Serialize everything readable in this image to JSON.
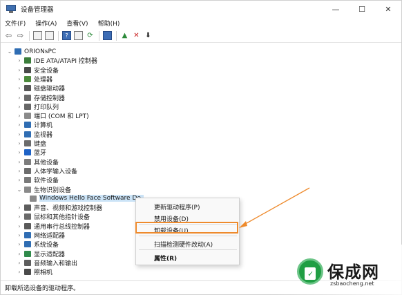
{
  "window": {
    "title": "设备管理器",
    "controls": {
      "minimize": "—",
      "maximize": "☐",
      "close": "✕"
    }
  },
  "menubar": {
    "items": [
      "文件(F)",
      "操作(A)",
      "查看(V)",
      "帮助(H)"
    ]
  },
  "toolbar": {
    "icons": [
      "back-icon",
      "forward-icon",
      "properties-icon",
      "view-icon",
      "help-icon",
      "view2-icon",
      "scan-icon",
      "monitor-icon",
      "enable-driver-icon",
      "uninstall-icon",
      "download-icon"
    ]
  },
  "tree": {
    "root": "ORIONsPC",
    "categories": [
      {
        "label": "IDE ATA/ATAPI 控制器",
        "icon": "ide-icon",
        "color": "#3b7d3b"
      },
      {
        "label": "安全设备",
        "icon": "security-icon",
        "color": "#4a4a4a"
      },
      {
        "label": "处理器",
        "icon": "cpu-icon",
        "color": "#4c8a3c"
      },
      {
        "label": "磁盘驱动器",
        "icon": "disk-icon",
        "color": "#555555"
      },
      {
        "label": "存储控制器",
        "icon": "storage-icon",
        "color": "#6a6a6a"
      },
      {
        "label": "打印队列",
        "icon": "printer-icon",
        "color": "#666666"
      },
      {
        "label": "端口 (COM 和 LPT)",
        "icon": "port-icon",
        "color": "#8a8a8a"
      },
      {
        "label": "计算机",
        "icon": "computer-icon",
        "color": "#2f6db3"
      },
      {
        "label": "监视器",
        "icon": "monitor-icon",
        "color": "#2f6db3"
      },
      {
        "label": "键盘",
        "icon": "keyboard-icon",
        "color": "#6b6b6b"
      },
      {
        "label": "蓝牙",
        "icon": "bluetooth-icon",
        "color": "#1e62c6"
      },
      {
        "label": "其他设备",
        "icon": "other-devices-icon",
        "color": "#7d7d7d"
      },
      {
        "label": "人体学输入设备",
        "icon": "hid-icon",
        "color": "#6d6d6d"
      },
      {
        "label": "软件设备",
        "icon": "software-icon",
        "color": "#7a7a7a"
      },
      {
        "label": "生物识别设备",
        "icon": "biometric-icon",
        "color": "#8a8a8a"
      },
      {
        "label": "Windows Hello Face Software De",
        "icon": "face-icon",
        "color": "#8a8a8a",
        "child": true
      },
      {
        "label": "声音、视频和游戏控制器",
        "icon": "audio-icon",
        "color": "#5d5d5d"
      },
      {
        "label": "鼠标和其他指针设备",
        "icon": "mouse-icon",
        "color": "#6a6a6a"
      },
      {
        "label": "通用串行总线控制器",
        "icon": "usb-icon",
        "color": "#5a5a5a"
      },
      {
        "label": "网络适配器",
        "icon": "network-icon",
        "color": "#2f6db3"
      },
      {
        "label": "系统设备",
        "icon": "system-icon",
        "color": "#2f6db3"
      },
      {
        "label": "显示适配器",
        "icon": "display-icon",
        "color": "#2f8a4a"
      },
      {
        "label": "音频输入和输出",
        "icon": "audio-io-icon",
        "color": "#5d5d5d"
      },
      {
        "label": "照相机",
        "icon": "camera-icon",
        "color": "#4a4a4a"
      }
    ]
  },
  "context_menu": {
    "items": [
      "更新驱动程序(P)",
      "禁用设备(D)",
      "卸载设备(U)",
      "扫描检测硬件改动(A)",
      "属性(R)"
    ],
    "highlighted": "卸载设备(U)"
  },
  "status_bar": {
    "text": "卸载所选设备的驱动程序。"
  },
  "watermark": {
    "brand": "保成网",
    "domain": "zsbaocheng.net",
    "accent": "#1f9e43"
  },
  "colors": {
    "highlight_box": "#ee8a2c",
    "selection": "#cce4f7"
  }
}
